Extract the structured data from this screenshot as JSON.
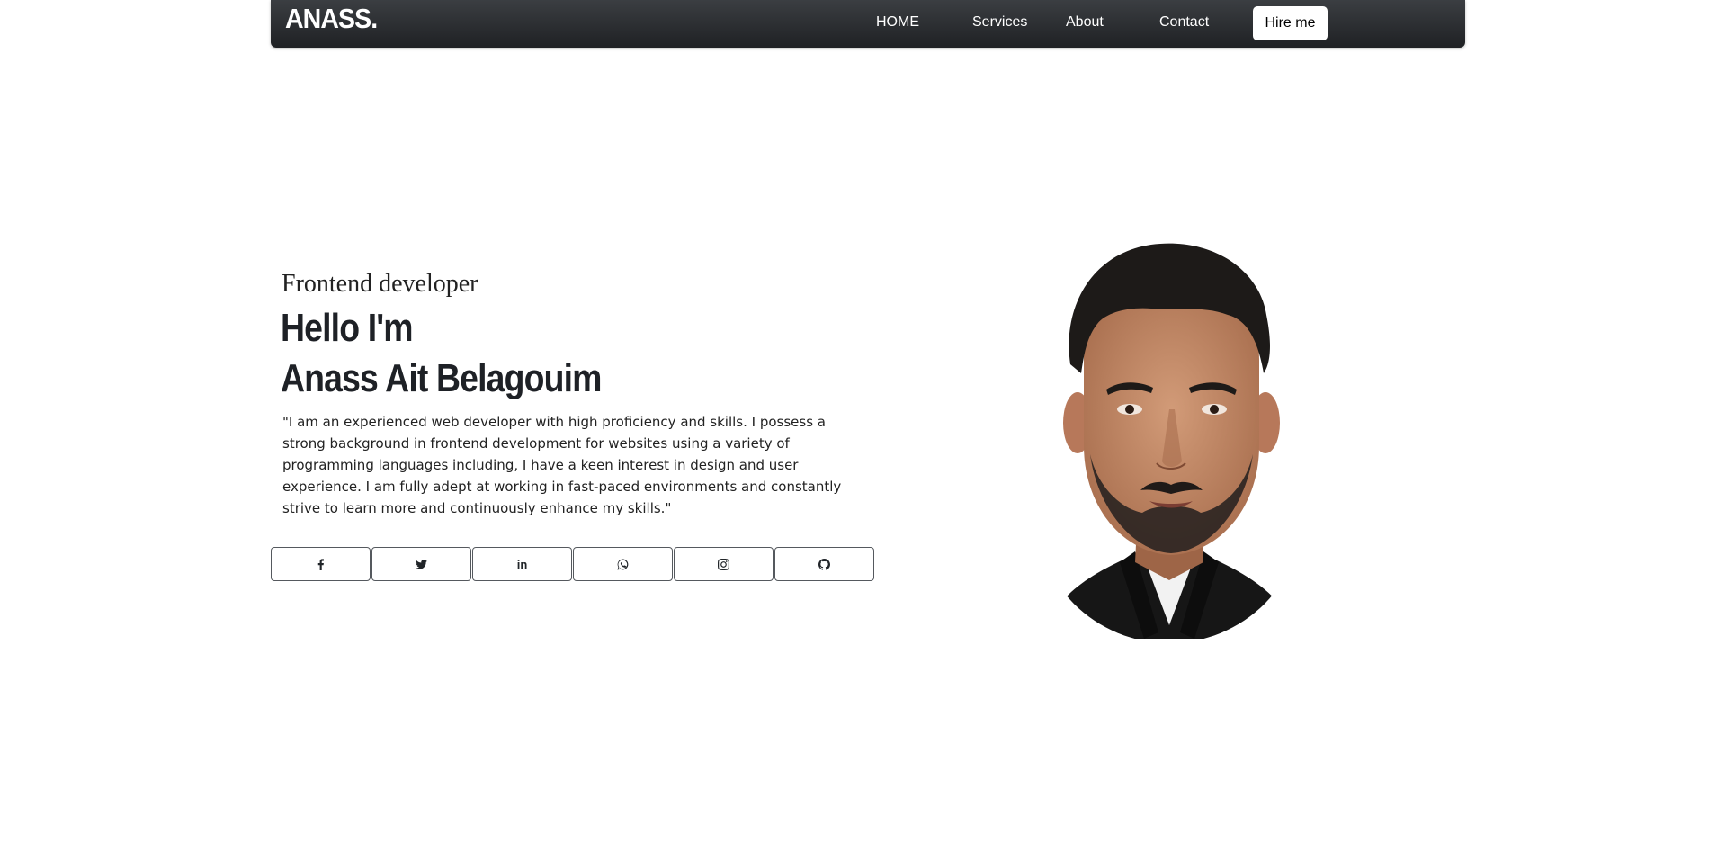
{
  "navbar": {
    "brand": "ANASS.",
    "links": [
      {
        "label": "HOME"
      },
      {
        "label": "Services"
      },
      {
        "label": "About"
      },
      {
        "label": "Contact"
      }
    ],
    "cta_label": "Hire me"
  },
  "hero": {
    "subtitle": "Frontend developer",
    "headline_line1": "Hello I'm",
    "headline_line2": "Anass Ait Belagouim",
    "bio": "\"I am an experienced web developer with high proficiency and skills. I possess a strong background in frontend development for websites using a variety of programming languages including, I have a keen interest in design and user experience. I am fully adept at working in fast-paced environments and constantly strive to learn more and continuously enhance my skills.\""
  },
  "socials": [
    {
      "icon": "facebook-icon"
    },
    {
      "icon": "twitter-icon"
    },
    {
      "icon": "linkedin-icon"
    },
    {
      "icon": "whatsapp-icon"
    },
    {
      "icon": "instagram-icon"
    },
    {
      "icon": "github-icon"
    }
  ],
  "portrait": {
    "icon": "profile-photo",
    "colors": {
      "skin": "#c8906e",
      "skin_shadow": "#a66c4c",
      "hair": "#1d1a18",
      "beard": "#2a2421",
      "jacket": "#161616"
    }
  },
  "colors": {
    "navbar_top": "#3b3e42",
    "navbar_bottom": "#1f2124",
    "text": "#1e2126",
    "button_border": "#55595e"
  }
}
